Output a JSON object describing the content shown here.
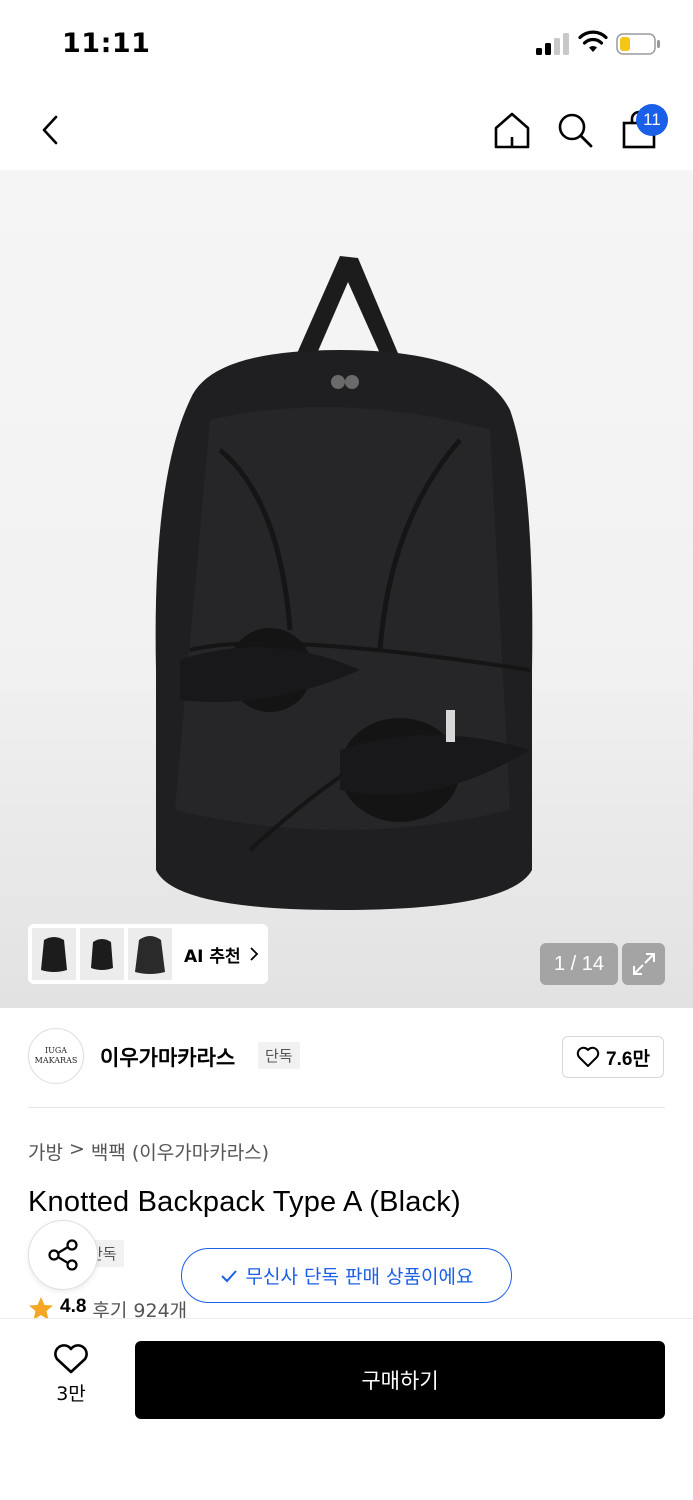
{
  "status_bar": {
    "time": "11:11",
    "icons": [
      "signal-icon",
      "wifi-icon",
      "battery-icon"
    ]
  },
  "nav": {
    "icons": [
      "back-icon",
      "home-icon",
      "search-icon",
      "shopping-bag-icon"
    ],
    "cart_count": "11",
    "badge_color": "#1a5fe8"
  },
  "gallery": {
    "ai_recommend_label": "AI 추천",
    "counter": "1 / 14",
    "thumbnails": [
      "backpack-front",
      "backpack-small",
      "backpack-side"
    ]
  },
  "brand": {
    "logo_line1": "IUGA",
    "logo_line2": "MAKARAS",
    "name": "이우가마카라스",
    "exclusive_tag": "단독",
    "likes": "7.6만"
  },
  "breadcrumb": {
    "category": "가방",
    "separator": ">",
    "subcategory": "백팩 (이우가마카라스)"
  },
  "product": {
    "title": "Knotted Backpack Type A (Black)",
    "exclusive_tag": "단독",
    "exclusive_notice": "무신사 단독 판매 상품이에요",
    "rating": "4.8",
    "review_label": "후기 924개"
  },
  "bottom_bar": {
    "wish_count": "3만",
    "buy_label": "구매하기"
  },
  "colors": {
    "accent": "#1a5fe8",
    "star": "#f5a623",
    "buy_button": "#000000"
  }
}
